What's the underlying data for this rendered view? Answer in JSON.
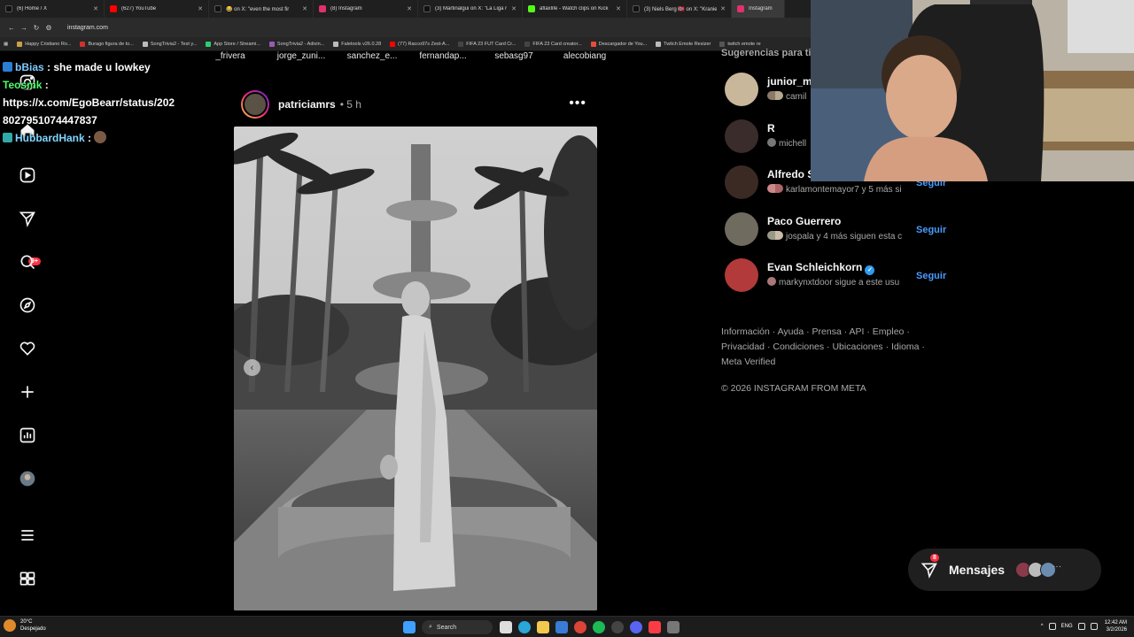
{
  "browser": {
    "tabs": [
      {
        "label": "(6) Home / X",
        "color": "#111111"
      },
      {
        "label": "(627) YouTube",
        "color": "#ff0000"
      },
      {
        "label": "😂 on X: \"even the most fir",
        "color": "#111111"
      },
      {
        "label": "(8) Instagram",
        "color": "#e1306c"
      },
      {
        "label": "(3) Martinalgui on X: \"La Liga r",
        "color": "#111111"
      },
      {
        "label": "aflaxlife - Watch clips on Kick",
        "color": "#53fc18"
      },
      {
        "label": "(3) Niels Berg 🇳🇴 on X: \"Kranie",
        "color": "#111111"
      },
      {
        "label": "Instagram",
        "color": "#e1306c"
      }
    ],
    "url": "instagram.com",
    "bookmarks": [
      {
        "label": "Happy Cristiano Ro...",
        "color": "#c9a14a"
      },
      {
        "label": "Burago figura de to...",
        "color": "#d32f2f"
      },
      {
        "label": "SongTrivia2 - Test y...",
        "color": "#bbbbbb"
      },
      {
        "label": "App Store / Streami...",
        "color": "#2ecc71"
      },
      {
        "label": "SongTrivia2 - Adivin...",
        "color": "#9b59b6"
      },
      {
        "label": "Faletools v26.0.28",
        "color": "#bbbbbb"
      },
      {
        "label": "(77) Racco97s Zest-A...",
        "color": "#ff0000"
      },
      {
        "label": "FIFA 23 FUT Card Cr...",
        "color": "#444444"
      },
      {
        "label": "FIFA 23 Card creator...",
        "color": "#444444"
      },
      {
        "label": "Descargador de You...",
        "color": "#e74c3c"
      },
      {
        "label": "Twitch Emote Resizer",
        "color": "#bbbbbb"
      },
      {
        "label": "twitch emote re",
        "color": "#555555"
      }
    ]
  },
  "chat": {
    "lines": [
      {
        "user": "bBias",
        "message": " : she made u lowkey"
      },
      {
        "user": "Teosmk",
        "message": " :"
      },
      {
        "user": "",
        "message": "https://x.com/EgoBearr/status/202"
      },
      {
        "user": "",
        "message": "8027951074447837"
      },
      {
        "user": "HubbardHank",
        "message": " :"
      }
    ]
  },
  "stories": [
    "_frivera",
    "jorge_zuni...",
    "sanchez_e...",
    "fernandap...",
    "sebasg97",
    "alecobiang"
  ],
  "nav": {
    "notification_count": "9+",
    "icons": [
      "home-icon",
      "reels-icon",
      "messages-icon",
      "search-icon",
      "explore-icon",
      "notifications-icon",
      "create-icon",
      "dashboard-icon",
      "profile-icon",
      "menu-icon",
      "more-icon"
    ]
  },
  "post": {
    "username": "patriciamrs",
    "time": "• 5 h",
    "more": "•••",
    "image_desc": "black-and-white photo"
  },
  "suggestions": {
    "title": "Sugerencias para ti",
    "items": [
      {
        "name": "junior_m",
        "sub": "camil",
        "follow": "",
        "verified": false,
        "avatar": "#c9b79c"
      },
      {
        "name": "R",
        "sub": "michell",
        "follow": "",
        "verified": false,
        "avatar": "#3a2c2a"
      },
      {
        "name": "Alfredo S",
        "sub": "karlamontemayor7 y 5 más si",
        "follow": "Seguir",
        "verified": false,
        "avatar": "#3b2a24"
      },
      {
        "name": "Paco Guerrero",
        "sub": "jospala y 4 más siguen esta c",
        "follow": "Seguir",
        "verified": false,
        "avatar": "#6f6b5e"
      },
      {
        "name": "Evan Schleichkorn",
        "sub": "markynxtdoor sigue a este usu",
        "follow": "Seguir",
        "verified": true,
        "avatar": "#b33a3a"
      }
    ]
  },
  "footer": {
    "links": "Información · Ayuda · Prensa · API · Empleo · Privacidad · Condiciones · Ubicaciones · Idioma · Meta Verified",
    "copyright": "© 2026 INSTAGRAM FROM META"
  },
  "messages": {
    "label": "Mensajes",
    "badge": "8"
  },
  "taskbar": {
    "weather_temp": "20°C",
    "weather_desc": "Despejado",
    "search": "Search",
    "lang": "ENG",
    "time": "12:42 AM",
    "date": "3/2/2026"
  }
}
